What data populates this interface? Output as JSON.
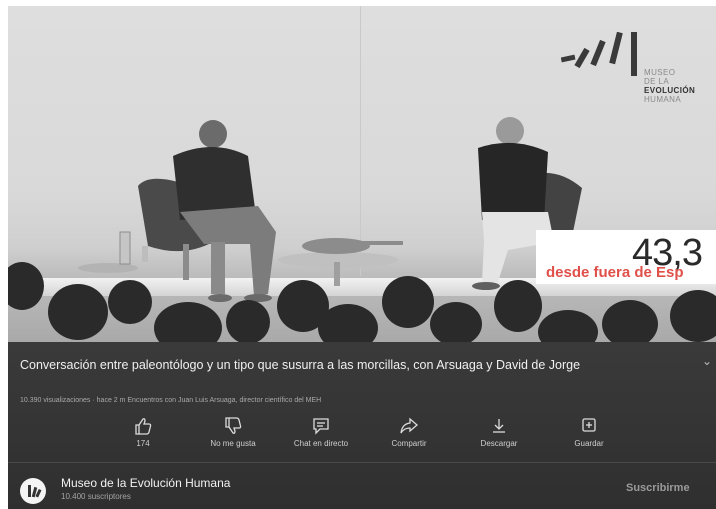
{
  "video": {
    "overlay_number": "43,3",
    "overlay_subtitle": "desde fuera de Esp",
    "logo": {
      "lines": [
        "MUSEO",
        "DE LA",
        "EVOLUCIÓN",
        "HUMANA"
      ]
    }
  },
  "info": {
    "title": "Conversación entre paleontólogo y un tipo que susurra a las morcillas, con Arsuaga y David de Jorge",
    "expand_icon": "chevron-down-icon",
    "meta": "10.390 visualizaciones · hace 2 m  Encuentros con Juan Luis Arsuaga, director científico del MEH"
  },
  "actions": [
    {
      "icon": "thumbs-up-icon",
      "label": "174"
    },
    {
      "icon": "thumbs-down-icon",
      "label": "No me gusta"
    },
    {
      "icon": "live-chat-icon",
      "label": "Chat en directo"
    },
    {
      "icon": "share-icon",
      "label": "Compartir"
    },
    {
      "icon": "download-icon",
      "label": "Descargar"
    },
    {
      "icon": "save-icon",
      "label": "Guardar"
    }
  ],
  "channel": {
    "name": "Museo de la Evolución Humana",
    "subscribers": "10.400 suscriptores",
    "subscribe_label": "Suscribirme"
  }
}
